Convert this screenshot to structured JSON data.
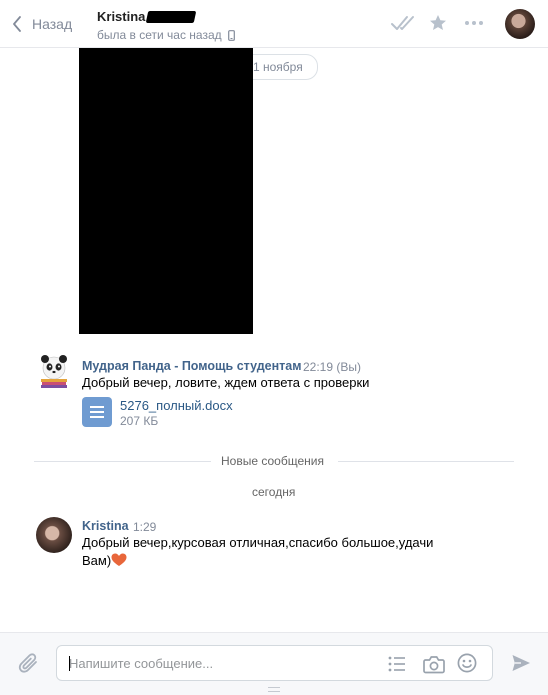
{
  "header": {
    "back_label": "Назад",
    "peer_name": "Kristina",
    "peer_status": "была в сети час назад",
    "icons": [
      "chevron-left-icon",
      "double-check-icon",
      "star-icon",
      "more-dots-icon",
      "mobile-icon"
    ]
  },
  "chat": {
    "date_pill": "1 ноября",
    "messages": [
      {
        "author": "Мудрая Панда - Помощь студентам",
        "time": "22:19",
        "suffix": "(Вы)",
        "text": "Добрый вечер, ловите, ждем ответа с проверки",
        "attachment": {
          "name": "5276_полный.docx",
          "size": "207 КБ",
          "icon": "document-icon"
        }
      },
      {
        "author": "Kristina",
        "time": "1:29",
        "text_line1": "Добрый вечер,курсовая отличная,спасибо большое,удачи",
        "text_line2": "Вам)"
      }
    ],
    "new_messages_label": "Новые сообщения",
    "today_label": "сегодня"
  },
  "composer": {
    "placeholder": "Напишите сообщение...",
    "value": "",
    "icons": [
      "paperclip-icon",
      "list-icon",
      "camera-icon",
      "smile-icon",
      "send-icon"
    ]
  },
  "colors": {
    "link": "#42648b",
    "muted": "#828a99",
    "doc": "#6f9bd1",
    "heart": "#e8663a"
  }
}
